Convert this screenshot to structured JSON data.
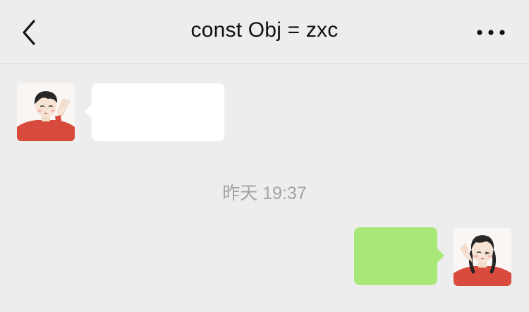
{
  "header": {
    "title": "const Obj = zxc",
    "back_icon": "chevron-left-icon",
    "more_icon": "more-horizontal-icon"
  },
  "messages": [
    {
      "sender": "contact",
      "bubble_color": "#ffffff",
      "avatar": "boy-avatar"
    },
    {
      "sender": "self",
      "bubble_color": "#a8e878",
      "avatar": "girl-avatar"
    }
  ],
  "timestamp": "昨天 19:37",
  "colors": {
    "background": "#ededed",
    "incoming_bubble": "#ffffff",
    "outgoing_bubble": "#a8e878",
    "timestamp_text": "#a3a3a3"
  }
}
